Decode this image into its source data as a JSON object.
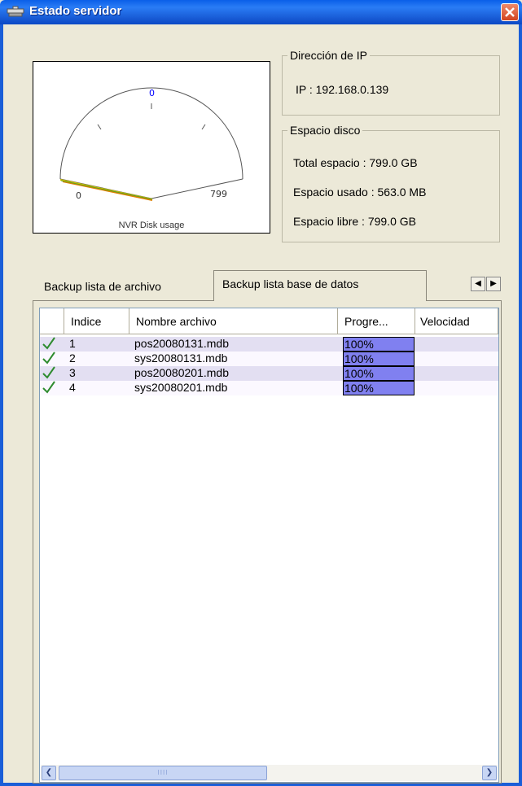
{
  "window": {
    "title": "Estado servidor"
  },
  "gauge": {
    "caption": "NVR Disk usage",
    "min_label": "0",
    "max_label": "799",
    "top_label": "0",
    "min": 0,
    "max": 799,
    "value": 0.55
  },
  "ip_group": {
    "legend": "Dirección de IP",
    "ip_text": "IP : 192.168.0.139"
  },
  "disk_group": {
    "legend": "Espacio disco",
    "total": "Total espacio : 799.0 GB",
    "used": "Espacio usado : 563.0 MB",
    "free": "Espacio libre : 799.0 GB"
  },
  "tabs": [
    {
      "label": "Backup lista de archivo",
      "active": false
    },
    {
      "label": "Backup lista base de datos",
      "active": true
    }
  ],
  "table": {
    "columns": [
      "",
      "Indice",
      "Nombre archivo",
      "Progre...",
      "Velocidad"
    ],
    "rows": [
      {
        "index": "1",
        "file": "pos20080131.mdb",
        "progress": "100%"
      },
      {
        "index": "2",
        "file": "sys20080131.mdb",
        "progress": "100%"
      },
      {
        "index": "3",
        "file": "pos20080201.mdb",
        "progress": "100%"
      },
      {
        "index": "4",
        "file": "sys20080201.mdb",
        "progress": "100%"
      }
    ]
  },
  "colors": {
    "titlebar": "#1A5ED8",
    "progress_fill": "#8080F0",
    "row_stripe": "#E3DFF2",
    "check": "#2E8B2E"
  }
}
